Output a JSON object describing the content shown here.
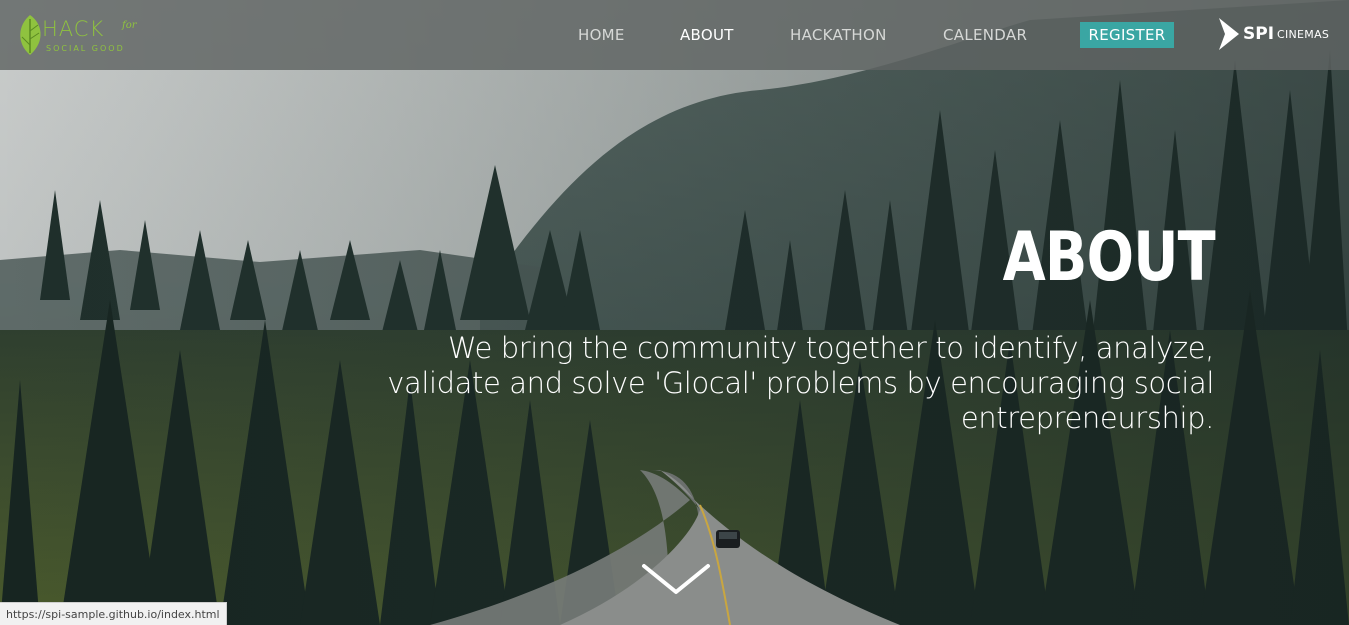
{
  "logo": {
    "hack": "HACK",
    "for": "for",
    "social": "SOCIAL GOOD"
  },
  "nav": {
    "items": [
      {
        "label": "HOME"
      },
      {
        "label": "ABOUT"
      },
      {
        "label": "HACKATHON"
      },
      {
        "label": "CALENDAR"
      }
    ],
    "active": "ABOUT",
    "register_label": "REGISTER"
  },
  "sponsor": {
    "spi": "SPI",
    "cinemas": "CINEMAS"
  },
  "hero": {
    "title": "ABOUT",
    "description": "We bring the community together to identify, analyze, validate and solve 'Glocal' problems by encouraging social entrepreneurship."
  },
  "icons": {
    "logo_leaf": "leaf-icon",
    "sponsor_mark": "spi-chevron-icon",
    "scroll": "chevron-down-icon"
  },
  "status_bar": {
    "url": "https://spi-sample.github.io/index.html"
  },
  "colors": {
    "accent": "#3aa6a3",
    "logo_green": "#8fc23f",
    "nav_bg": "#5f6463"
  }
}
